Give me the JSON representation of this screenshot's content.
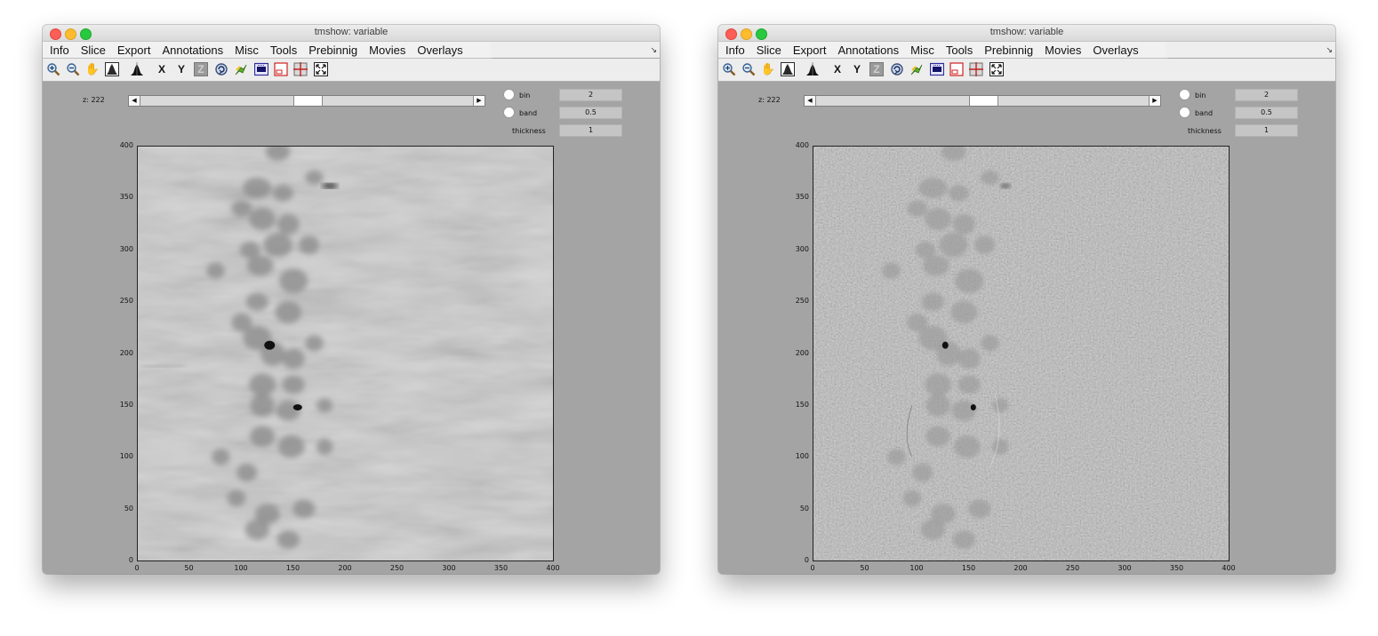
{
  "windows": [
    {
      "title": "tmshow: variable",
      "menus": [
        "Info",
        "Slice",
        "Export",
        "Annotations",
        "Misc",
        "Tools",
        "Prebinnig",
        "Movies",
        "Overlays"
      ],
      "menu_expand_glyph": "↘",
      "toolbar_icons": [
        {
          "name": "zoom-in-icon",
          "glyph": ""
        },
        {
          "name": "zoom-out-icon",
          "glyph": ""
        },
        {
          "name": "pan-hand-icon",
          "glyph": "✋"
        },
        {
          "name": "histogram-icon",
          "glyph": ""
        },
        {
          "name": "histogram-black-icon",
          "glyph": ""
        },
        {
          "name": "x-axis-icon",
          "glyph": "X"
        },
        {
          "name": "y-axis-icon",
          "glyph": "Y"
        },
        {
          "name": "z-axis-icon",
          "glyph": "Z"
        },
        {
          "name": "rotate-icon",
          "glyph": ""
        },
        {
          "name": "satellite-icon",
          "glyph": ""
        },
        {
          "name": "film-icon",
          "glyph": ""
        },
        {
          "name": "frame-icon",
          "glyph": ""
        },
        {
          "name": "crosshair-icon",
          "glyph": ""
        },
        {
          "name": "fullscreen-icon",
          "glyph": ""
        }
      ],
      "z_label": "z: 222",
      "slider_value": 0.5,
      "params": {
        "bin": {
          "label": "bin",
          "value": "2"
        },
        "band": {
          "label": "band",
          "value": "0.5"
        },
        "thickness": {
          "label": "thickness",
          "value": "1"
        }
      },
      "axes": {
        "x_ticks": [
          "0",
          "50",
          "100",
          "150",
          "200",
          "250",
          "300",
          "350",
          "400"
        ],
        "y_ticks": [
          "400",
          "350",
          "300",
          "250",
          "200",
          "150",
          "100",
          "50",
          "0"
        ],
        "xlim": [
          0,
          400
        ],
        "ylim": [
          0,
          400
        ]
      },
      "image_style": "smooth"
    },
    {
      "title": "tmshow: variable",
      "menus": [
        "Info",
        "Slice",
        "Export",
        "Annotations",
        "Misc",
        "Tools",
        "Prebinnig",
        "Movies",
        "Overlays"
      ],
      "menu_expand_glyph": "↘",
      "toolbar_icons": [
        {
          "name": "zoom-in-icon",
          "glyph": ""
        },
        {
          "name": "zoom-out-icon",
          "glyph": ""
        },
        {
          "name": "pan-hand-icon",
          "glyph": "✋"
        },
        {
          "name": "histogram-icon",
          "glyph": ""
        },
        {
          "name": "histogram-black-icon",
          "glyph": ""
        },
        {
          "name": "x-axis-icon",
          "glyph": "X"
        },
        {
          "name": "y-axis-icon",
          "glyph": "Y"
        },
        {
          "name": "z-axis-icon",
          "glyph": "Z"
        },
        {
          "name": "rotate-icon",
          "glyph": ""
        },
        {
          "name": "satellite-icon",
          "glyph": ""
        },
        {
          "name": "film-icon",
          "glyph": ""
        },
        {
          "name": "frame-icon",
          "glyph": ""
        },
        {
          "name": "crosshair-icon",
          "glyph": ""
        },
        {
          "name": "fullscreen-icon",
          "glyph": ""
        }
      ],
      "z_label": "z: 222",
      "slider_value": 0.5,
      "params": {
        "bin": {
          "label": "bin",
          "value": "2"
        },
        "band": {
          "label": "band",
          "value": "0.5"
        },
        "thickness": {
          "label": "thickness",
          "value": "1"
        }
      },
      "axes": {
        "x_ticks": [
          "0",
          "50",
          "100",
          "150",
          "200",
          "250",
          "300",
          "350",
          "400"
        ],
        "y_ticks": [
          "400",
          "350",
          "300",
          "250",
          "200",
          "150",
          "100",
          "50",
          "0"
        ],
        "xlim": [
          0,
          400
        ],
        "ylim": [
          0,
          400
        ]
      },
      "image_style": "noisy"
    }
  ]
}
